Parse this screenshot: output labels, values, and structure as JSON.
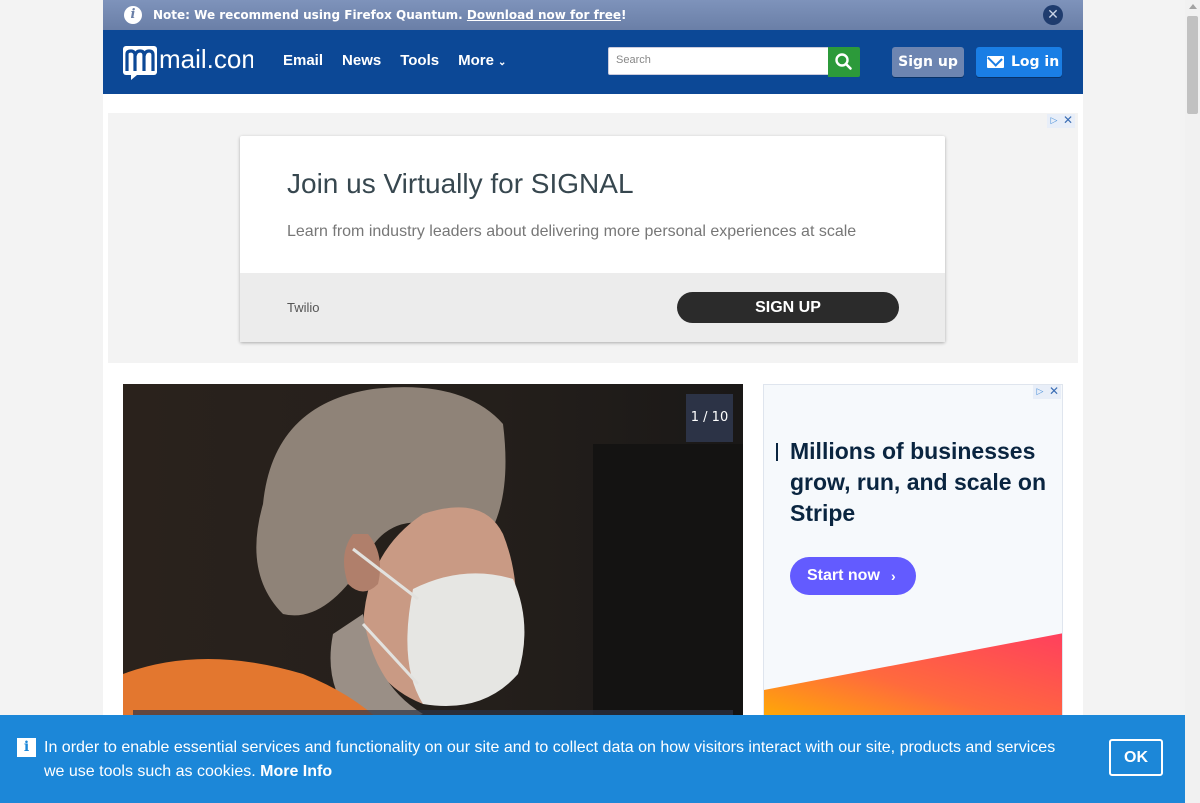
{
  "notice": {
    "text": "Note: We recommend using Firefox Quantum.",
    "link": "Download now for free",
    "suffix": "!",
    "info_icon": "i"
  },
  "header": {
    "logo": "mail.com",
    "nav": [
      "Email",
      "News",
      "Tools",
      "More"
    ],
    "search_placeholder": "Search",
    "signup_label": "Sign up",
    "login_label": "Log in"
  },
  "ad1": {
    "headline": "Join us Virtually for SIGNAL",
    "subtext": "Learn from industry leaders about delivering more personal experiences at scale",
    "brand": "Twilio",
    "cta": "SIGN UP"
  },
  "gallery": {
    "counter": "1 / 10"
  },
  "ad2": {
    "headline": "Millions of businesses grow, run, and scale on Stripe",
    "cta": "Start now"
  },
  "cookie": {
    "text": "In order to enable essential services and functionality on our site and to collect data on how visitors interact with our site, products and services we use tools such as cookies.",
    "more_info": "More Info",
    "ok": "OK"
  },
  "colors": {
    "header_bg": "#0c4896",
    "cookie_bg": "#1c87d8",
    "search_button": "#2c9a3a",
    "stripe_accent": "#635bff"
  }
}
